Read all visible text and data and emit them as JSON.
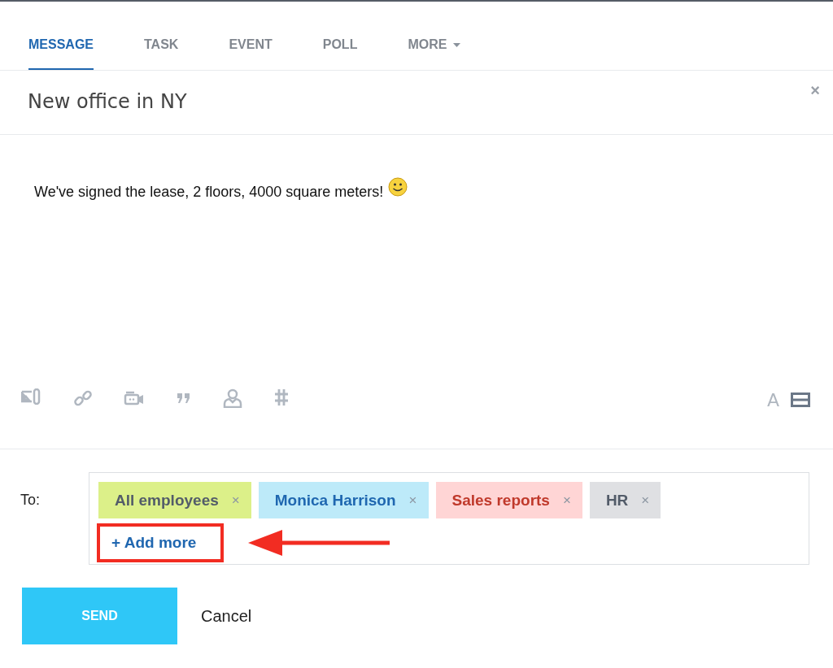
{
  "tabs": [
    {
      "label": "MESSAGE",
      "selected": true,
      "dropdown": false
    },
    {
      "label": "TASK",
      "selected": false,
      "dropdown": false
    },
    {
      "label": "EVENT",
      "selected": false,
      "dropdown": false
    },
    {
      "label": "POLL",
      "selected": false,
      "dropdown": false
    },
    {
      "label": "MORE",
      "selected": false,
      "dropdown": true
    }
  ],
  "close": "×",
  "subject": "New office in NY",
  "body": "We've signed the lease, 2 floors, 4000 square meters!",
  "format_toolbar": {
    "text_style": "A"
  },
  "recipients": {
    "label": "To:",
    "tags": [
      {
        "name": "All employees",
        "remove": "×",
        "color": "#dcf089",
        "kind": "everyone"
      },
      {
        "name": "Monica Harrison",
        "remove": "×",
        "color": "#bdeaf9",
        "kind": "user"
      },
      {
        "name": "Sales reports",
        "remove": "×",
        "color": "#ffd5d5",
        "kind": "chat"
      },
      {
        "name": "HR",
        "remove": "×",
        "color": "#dfe0e3",
        "kind": "department"
      }
    ],
    "add_more": "+ Add more",
    "highlighted": true
  },
  "buttons": {
    "send": "SEND",
    "cancel": "Cancel"
  }
}
